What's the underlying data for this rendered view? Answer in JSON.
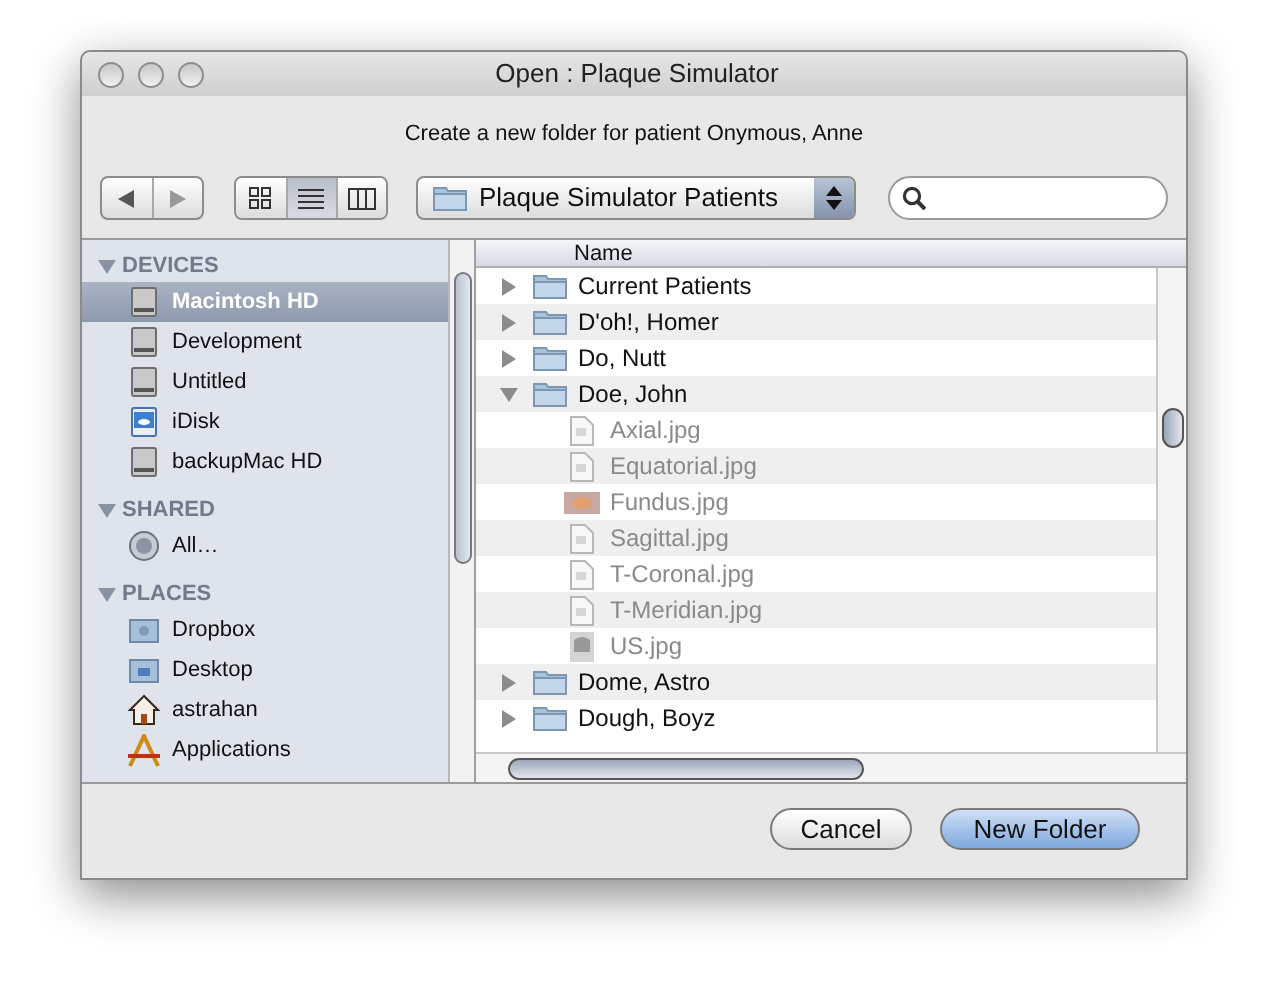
{
  "window": {
    "title": "Open : Plaque Simulator"
  },
  "message": "Create a new folder for patient Onymous, Anne",
  "toolbar": {
    "view_modes": [
      {
        "kind": "icon",
        "selected": false
      },
      {
        "kind": "list",
        "selected": true
      },
      {
        "kind": "column",
        "selected": false
      }
    ],
    "location": "Plaque Simulator Patients"
  },
  "sidebar": {
    "sections": [
      {
        "title": "DEVICES",
        "expanded": true,
        "items": [
          {
            "label": "Macintosh HD",
            "kind": "drive",
            "selected": true
          },
          {
            "label": "Development",
            "kind": "drive",
            "selected": false
          },
          {
            "label": "Untitled",
            "kind": "drive",
            "selected": false
          },
          {
            "label": "iDisk",
            "kind": "idisk",
            "selected": false
          },
          {
            "label": "backupMac HD",
            "kind": "drive",
            "selected": false
          }
        ]
      },
      {
        "title": "SHARED",
        "expanded": true,
        "items": [
          {
            "label": "All…",
            "kind": "network",
            "selected": false
          }
        ]
      },
      {
        "title": "PLACES",
        "expanded": true,
        "items": [
          {
            "label": "Dropbox",
            "kind": "folder",
            "selected": false
          },
          {
            "label": "Desktop",
            "kind": "desktop",
            "selected": false
          },
          {
            "label": "astrahan",
            "kind": "home",
            "selected": false
          },
          {
            "label": "Applications",
            "kind": "apps",
            "selected": false
          }
        ]
      }
    ]
  },
  "file_list": {
    "columns": [
      "Name"
    ],
    "rows": [
      {
        "name": "Current Patients",
        "kind": "folder",
        "expanded": false
      },
      {
        "name": "D'oh!, Homer",
        "kind": "folder",
        "expanded": false
      },
      {
        "name": "Do, Nutt",
        "kind": "folder",
        "expanded": false
      },
      {
        "name": "Doe, John",
        "kind": "folder",
        "expanded": true,
        "children": [
          {
            "name": "Axial.jpg",
            "kind": "file",
            "disabled": true
          },
          {
            "name": "Equatorial.jpg",
            "kind": "file",
            "disabled": true
          },
          {
            "name": "Fundus.jpg",
            "kind": "image",
            "disabled": true
          },
          {
            "name": "Sagittal.jpg",
            "kind": "file",
            "disabled": true
          },
          {
            "name": "T-Coronal.jpg",
            "kind": "file",
            "disabled": true
          },
          {
            "name": "T-Meridian.jpg",
            "kind": "file",
            "disabled": true
          },
          {
            "name": "US.jpg",
            "kind": "scan",
            "disabled": true
          }
        ]
      },
      {
        "name": "Dome, Astro",
        "kind": "folder",
        "expanded": false
      },
      {
        "name": "Dough, Boyz",
        "kind": "folder",
        "expanded": false
      }
    ]
  },
  "buttons": [
    {
      "label": "Cancel",
      "default": false
    },
    {
      "label": "New Folder",
      "default": true
    }
  ]
}
